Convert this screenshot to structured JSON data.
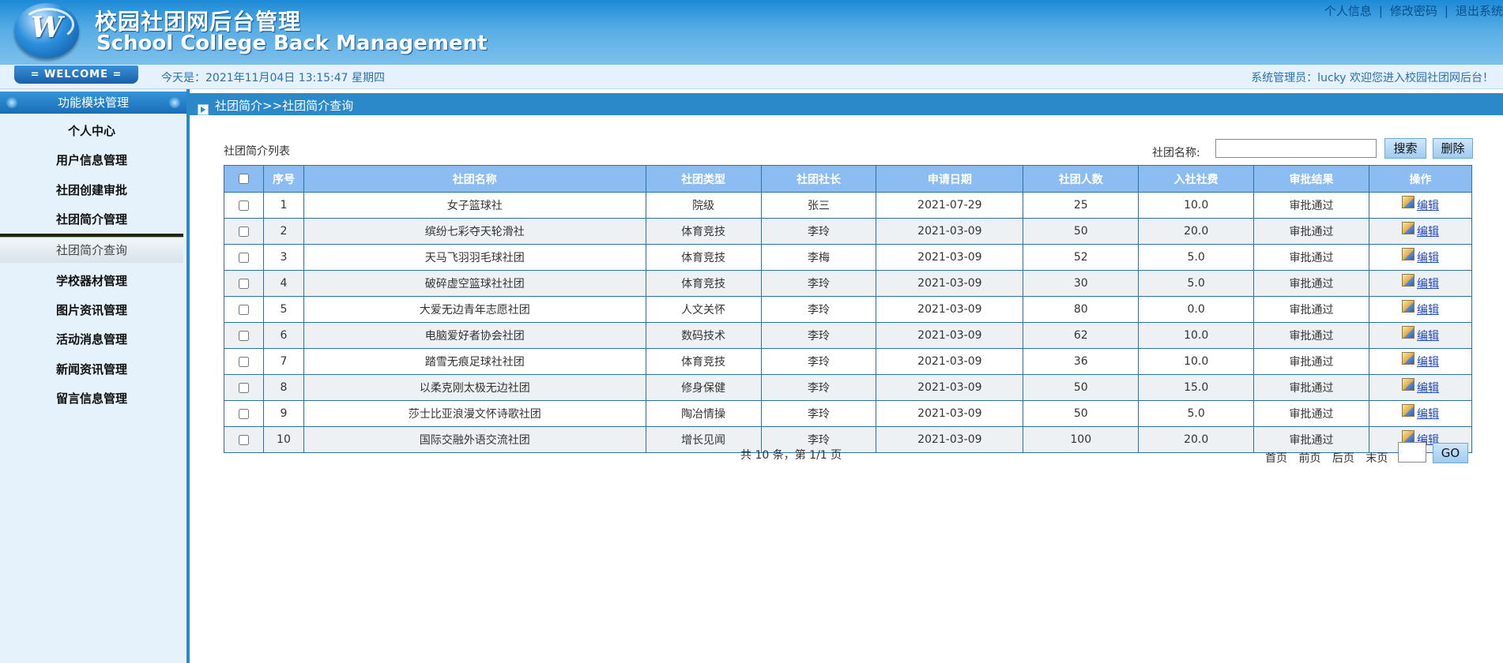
{
  "header": {
    "logo_letter": "W",
    "title_cn": "校园社团网后台管理",
    "title_en": "School College Back Management",
    "links": [
      "个人信息",
      "修改密码",
      "退出系统"
    ],
    "link_separator": "|"
  },
  "infobar": {
    "welcome": "= WELCOME =",
    "date": "今天是：2021年11月04日   13:15:47   星期四",
    "admin": "系统管理员：lucky    欢迎您进入校园社团网后台！"
  },
  "sidebar": {
    "heading": "功能模块管理",
    "items": [
      "个人中心",
      "用户信息管理",
      "社团创建审批",
      "社团简介管理",
      "学校器材管理",
      "图片资讯管理",
      "活动消息管理",
      "新闻资讯管理",
      "留言信息管理"
    ],
    "active_sub": "社团简介查询"
  },
  "breadcrumb": "社团简介>>社团简介查询",
  "list": {
    "label": "社团简介列表",
    "search_label": "社团名称:",
    "search_value": "",
    "search_button": "搜索",
    "delete_button": "删除",
    "columns": [
      "序号",
      "社团名称",
      "社团类型",
      "社团社长",
      "申请日期",
      "社团人数",
      "入社社费",
      "审批结果",
      "操作"
    ],
    "edit_label": "编辑",
    "rows": [
      [
        "1",
        "女子篮球社",
        "院级",
        "张三",
        "2021-07-29",
        "25",
        "10.0",
        "审批通过"
      ],
      [
        "2",
        "缤纷七彩夺天轮滑社",
        "体育竞技",
        "李玲",
        "2021-03-09",
        "50",
        "20.0",
        "审批通过"
      ],
      [
        "3",
        "天马飞羽羽毛球社团",
        "体育竞技",
        "李梅",
        "2021-03-09",
        "52",
        "5.0",
        "审批通过"
      ],
      [
        "4",
        "破碎虚空篮球社社团",
        "体育竞技",
        "李玲",
        "2021-03-09",
        "30",
        "5.0",
        "审批通过"
      ],
      [
        "5",
        "大爱无边青年志愿社团",
        "人文关怀",
        "李玲",
        "2021-03-09",
        "80",
        "0.0",
        "审批通过"
      ],
      [
        "6",
        "电脑爱好者协会社团",
        "数码技术",
        "李玲",
        "2021-03-09",
        "62",
        "10.0",
        "审批通过"
      ],
      [
        "7",
        "踏雪无痕足球社社团",
        "体育竞技",
        "李玲",
        "2021-03-09",
        "36",
        "10.0",
        "审批通过"
      ],
      [
        "8",
        "以柔克刚太极无边社团",
        "修身保健",
        "李玲",
        "2021-03-09",
        "50",
        "15.0",
        "审批通过"
      ],
      [
        "9",
        "莎士比亚浪漫文怀诗歌社团",
        "陶冶情操",
        "李玲",
        "2021-03-09",
        "50",
        "5.0",
        "审批通过"
      ],
      [
        "10",
        "国际交融外语交流社团",
        "增长见闻",
        "李玲",
        "2021-03-09",
        "100",
        "20.0",
        "审批通过"
      ]
    ]
  },
  "pagination": {
    "info": "共 10 条，第 1/1 页",
    "links": [
      "首页",
      "前页",
      "后页",
      "末页"
    ],
    "page_value": "",
    "go_button": "GO"
  },
  "colors": {
    "header_blue": "#1d8ad7",
    "nav_blue": "#2b88c9",
    "table_header": "#8bbdf2",
    "sidebar_bg": "#e5f2fb"
  }
}
